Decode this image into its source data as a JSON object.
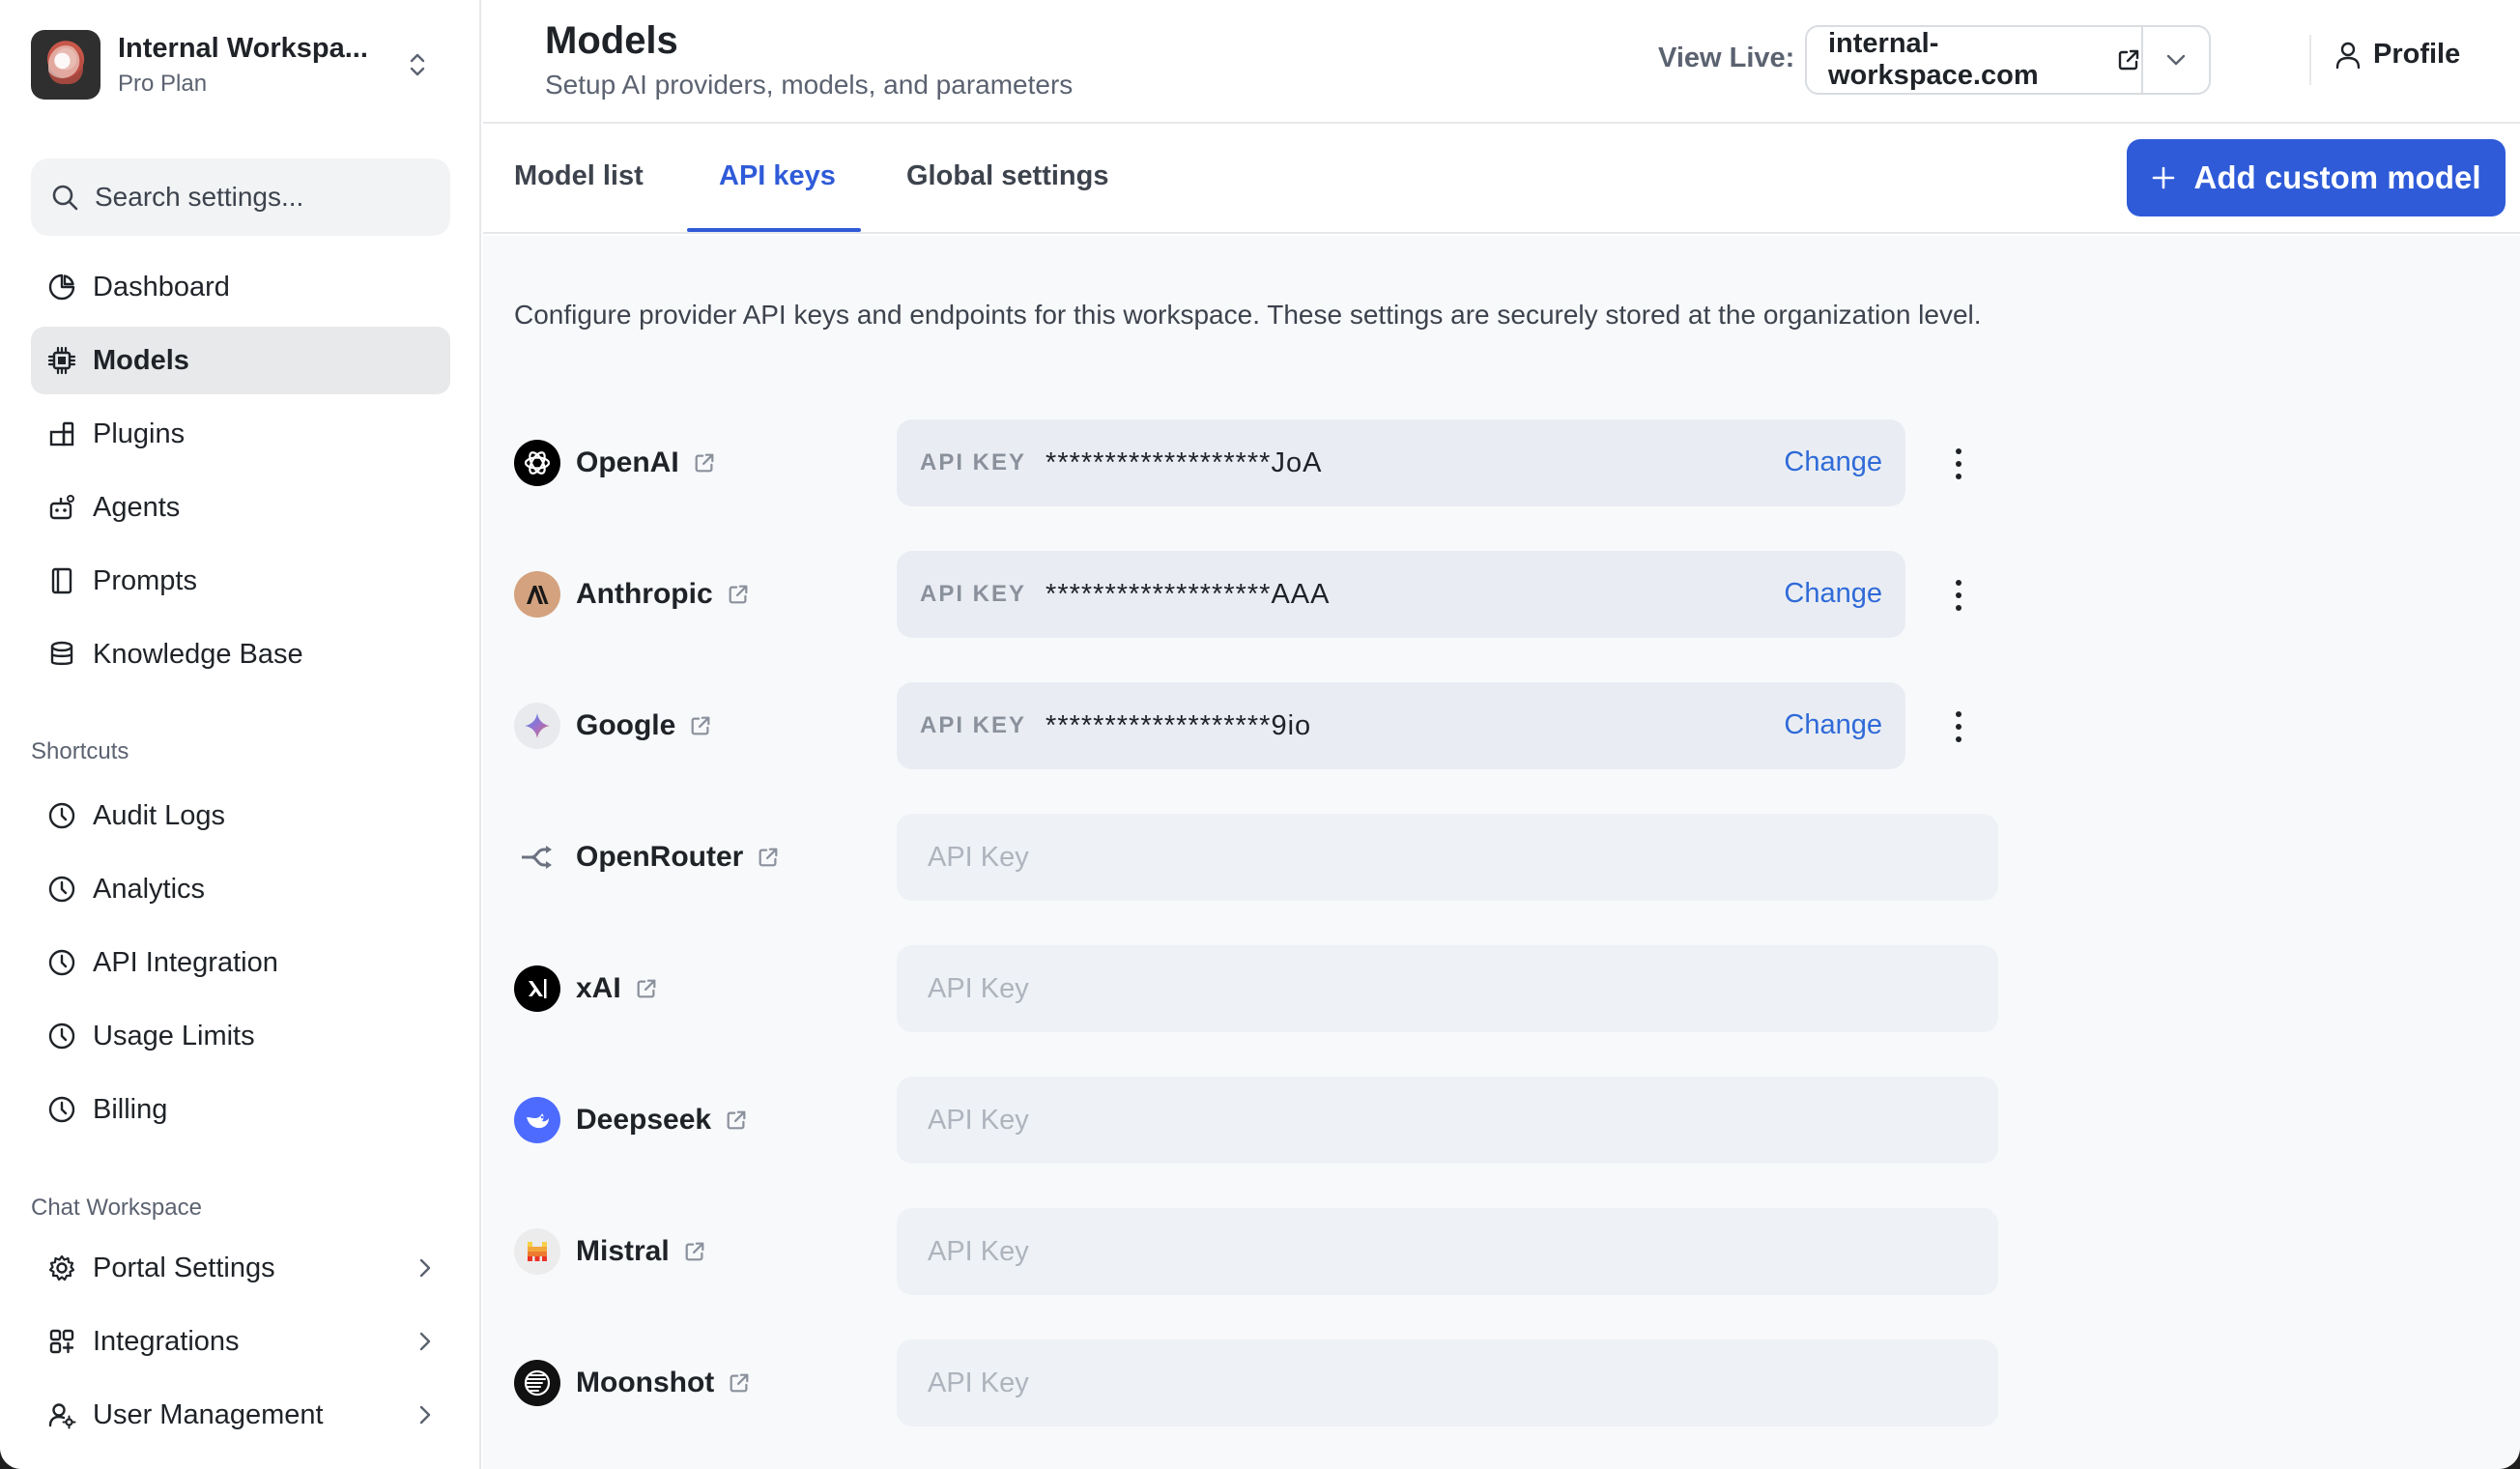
{
  "workspace": {
    "name": "Internal Workspa...",
    "plan": "Pro Plan"
  },
  "sidebar": {
    "search_placeholder": "Search settings...",
    "items": [
      {
        "label": "Dashboard",
        "icon": "pie-chart-icon"
      },
      {
        "label": "Models",
        "icon": "cpu-icon",
        "active": true
      },
      {
        "label": "Plugins",
        "icon": "blocks-icon"
      },
      {
        "label": "Agents",
        "icon": "bot-icon"
      },
      {
        "label": "Prompts",
        "icon": "book-icon"
      },
      {
        "label": "Knowledge Base",
        "icon": "database-icon"
      }
    ],
    "shortcuts_label": "Shortcuts",
    "shortcuts": [
      {
        "label": "Audit Logs",
        "icon": "clock-icon"
      },
      {
        "label": "Analytics",
        "icon": "clock-icon"
      },
      {
        "label": "API Integration",
        "icon": "clock-icon"
      },
      {
        "label": "Usage Limits",
        "icon": "clock-icon"
      },
      {
        "label": "Billing",
        "icon": "clock-icon"
      }
    ],
    "chat_label": "Chat Workspace",
    "chat_items": [
      {
        "label": "Portal Settings",
        "icon": "gear-icon"
      },
      {
        "label": "Integrations",
        "icon": "grid-plus-icon"
      },
      {
        "label": "User Management",
        "icon": "users-gear-icon"
      }
    ]
  },
  "header": {
    "title": "Models",
    "subtitle": "Setup AI providers, models, and parameters",
    "view_live_label": "View Live:",
    "url": "internal-workspace.com",
    "profile_label": "Profile"
  },
  "tabs": {
    "items": [
      "Model list",
      "API keys",
      "Global settings"
    ],
    "active": "API keys",
    "add_button": "Add custom model"
  },
  "content": {
    "description": "Configure provider API keys and endpoints for this workspace. These settings are securely stored at the organization level.",
    "key_label": "API KEY",
    "change_label": "Change",
    "input_placeholder": "API Key",
    "providers": [
      {
        "name": "OpenAI",
        "masked_key": "*******************JoA"
      },
      {
        "name": "Anthropic",
        "masked_key": "*******************AAA"
      },
      {
        "name": "Google",
        "masked_key": "*******************9io"
      },
      {
        "name": "OpenRouter"
      },
      {
        "name": "xAI"
      },
      {
        "name": "Deepseek"
      },
      {
        "name": "Mistral"
      },
      {
        "name": "Moonshot"
      }
    ]
  },
  "colors": {
    "accent": "#2f5bd8",
    "link": "#2f6ad8",
    "active_nav_bg": "#e8e9eb",
    "field_bg": "#e9edf3"
  }
}
